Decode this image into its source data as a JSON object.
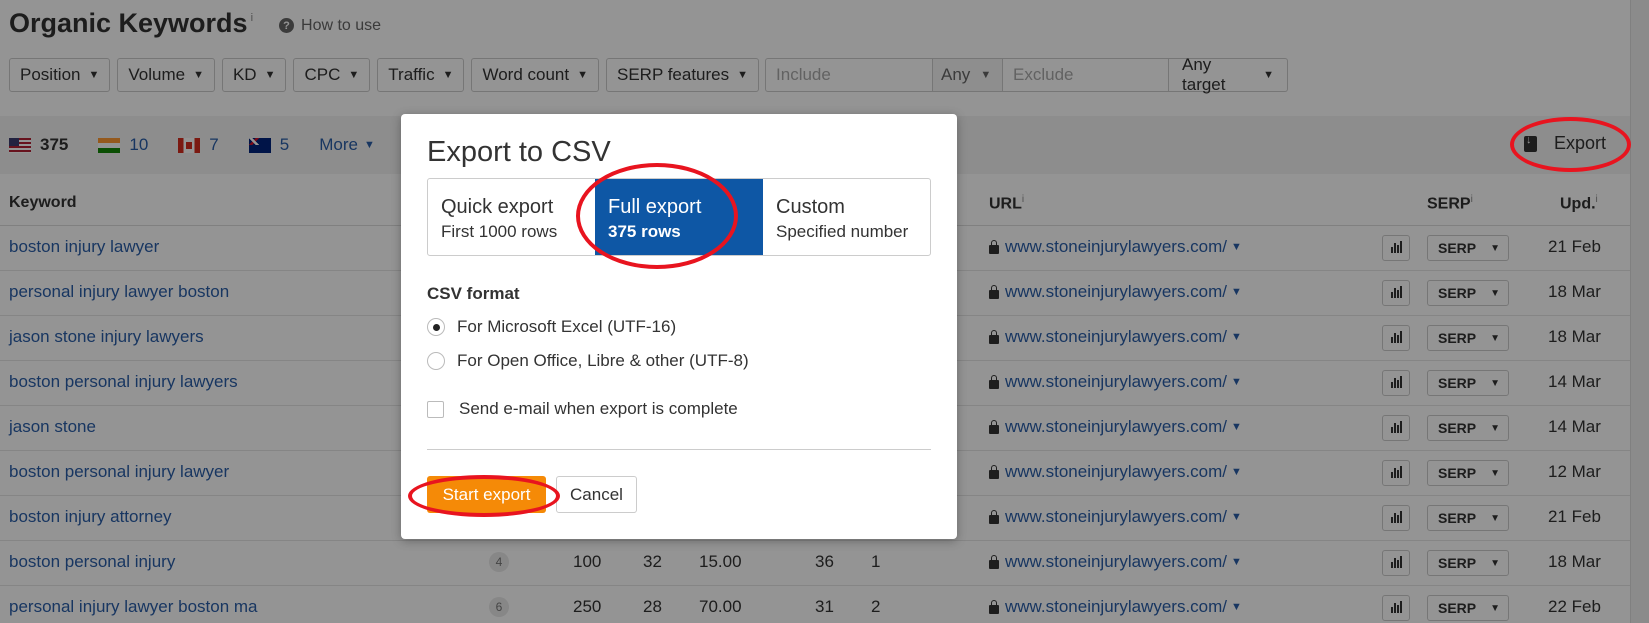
{
  "page": {
    "title": "Organic Keywords",
    "title_info": "i",
    "how_to_use": "How to use"
  },
  "filters": {
    "buttons": [
      "Position",
      "Volume",
      "KD",
      "CPC",
      "Traffic",
      "Word count",
      "SERP features"
    ],
    "include_placeholder": "Include",
    "any_label": "Any",
    "exclude_placeholder": "Exclude",
    "any_target_label": "Any target"
  },
  "countries": {
    "us_count": "375",
    "in_count": "10",
    "ca_count": "7",
    "au_count": "5",
    "more_label": "More"
  },
  "export_label": "Export",
  "table": {
    "headers": {
      "keyword": "Keyword",
      "url": "URL",
      "serp": "SERP",
      "upd": "Upd.",
      "info": "i"
    },
    "url_text": "www.stoneinjurylawyers.com/",
    "serp_btn": "SERP",
    "rows": [
      {
        "keyword": "boston injury lawyer",
        "upd": "21 Feb"
      },
      {
        "keyword": "personal injury lawyer boston",
        "upd": "18 Mar"
      },
      {
        "keyword": "jason stone injury lawyers",
        "upd": "18 Mar"
      },
      {
        "keyword": "boston personal injury lawyers",
        "upd": "14 Mar"
      },
      {
        "keyword": "jason stone",
        "upd": "14 Mar"
      },
      {
        "keyword": "boston personal injury lawyer",
        "upd": "12 Mar"
      },
      {
        "keyword": "boston injury attorney",
        "upd": "21 Feb"
      },
      {
        "keyword": "boston personal injury",
        "position": "4",
        "volume": "100",
        "kd": "32",
        "cpc": "15.00",
        "traffic": "36",
        "words": "1",
        "upd": "18 Mar"
      },
      {
        "keyword": "personal injury lawyer boston ma",
        "position": "6",
        "volume": "250",
        "kd": "28",
        "cpc": "70.00",
        "traffic": "31",
        "words": "2",
        "upd": "22 Feb"
      }
    ]
  },
  "modal": {
    "title": "Export to CSV",
    "options": [
      {
        "title": "Quick export",
        "subtitle": "First 1000 rows"
      },
      {
        "title": "Full export",
        "subtitle": "375 rows"
      },
      {
        "title": "Custom",
        "subtitle": "Specified number"
      }
    ],
    "selected_option": "Full export",
    "csv_format_label": "CSV format",
    "format_excel": "For Microsoft Excel (UTF-16)",
    "format_open": "For Open Office, Libre & other (UTF-8)",
    "email_checkbox": "Send e-mail when export is complete",
    "start_button": "Start export",
    "cancel_button": "Cancel"
  },
  "colors": {
    "accent_blue": "#0e57a5",
    "link_blue": "#2a5ea8",
    "start_orange": "#f58a07",
    "annotation_red": "#e8141f"
  }
}
